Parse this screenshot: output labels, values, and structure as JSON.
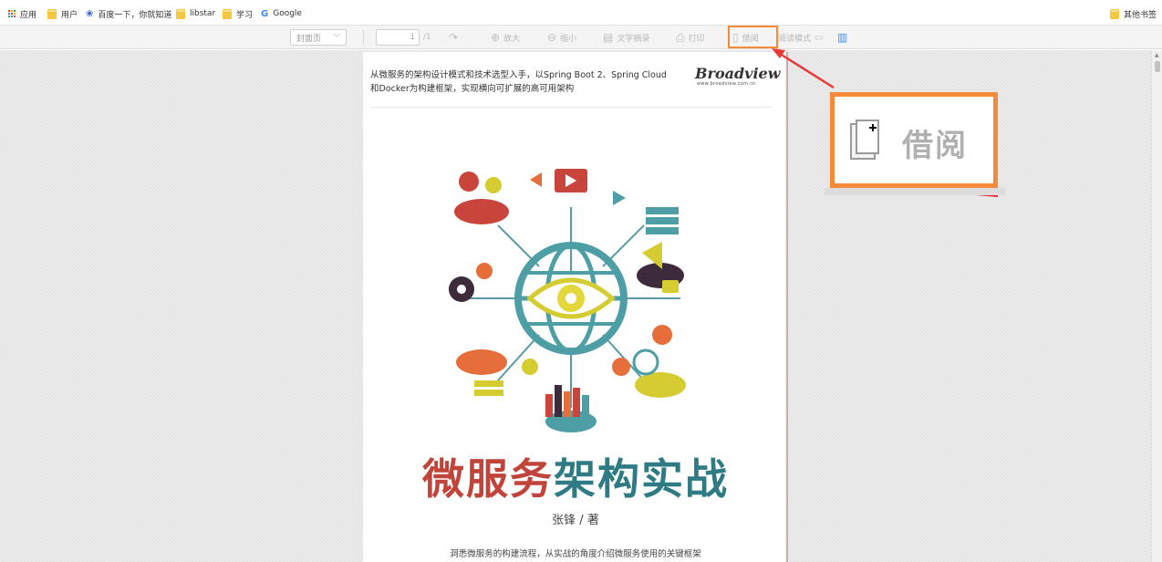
{
  "bookmarks": {
    "items": [
      {
        "label": "应用",
        "icon": "apps-grid-icon"
      },
      {
        "label": "用户",
        "icon": "folder-icon"
      },
      {
        "label": "百度一下，你就知道",
        "icon": "baidu-paw-icon"
      },
      {
        "label": "libstar",
        "icon": "folder-icon"
      },
      {
        "label": "学习",
        "icon": "folder-icon"
      },
      {
        "label": "Google",
        "icon": "google-g-icon"
      }
    ],
    "other": "其他书签"
  },
  "toolbar": {
    "page_select": "封面页",
    "page_current": "1",
    "page_total": "/1",
    "zoom_in": "放大",
    "zoom_out": "缩小",
    "text_extract": "文字摘录",
    "print": "打印",
    "borrow": "借阅",
    "reading_mode": "阅读模式"
  },
  "callout": {
    "label": "借阅"
  },
  "colors": {
    "highlight": "#f58a3a",
    "title_red": "#c1443a",
    "title_teal": "#2e7b84",
    "arrow": "#e83a3a"
  },
  "book": {
    "tagline_line1": "从微服务的架构设计模式和技术选型入手，以Spring Boot 2、Spring Cloud",
    "tagline_line2": "和Docker为构建框架，实现横向可扩展的高可用架构",
    "publisher": "Broadview",
    "publisher_url": "www.broadview.com.cn",
    "title_part1": "微服务",
    "title_part2": "架构实战",
    "author": "张锋 / 著",
    "description": "洞悉微服务的构建流程，从实战的角度介绍微服务使用的关键框架"
  }
}
